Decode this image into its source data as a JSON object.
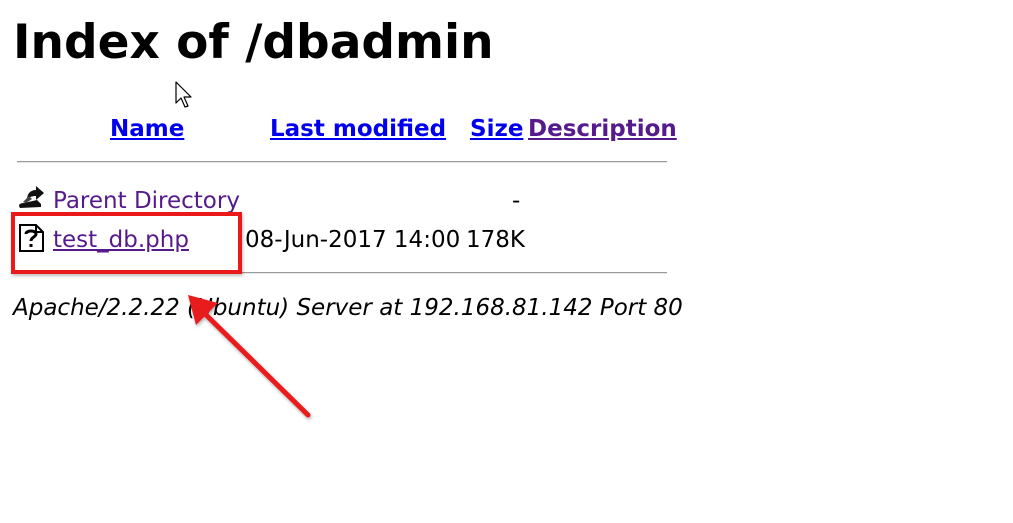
{
  "page": {
    "title": "Index of /dbadmin"
  },
  "table": {
    "headers": {
      "name": "Name",
      "last_modified": "Last modified",
      "size": "Size",
      "description": "Description"
    },
    "rows": [
      {
        "icon": "back-icon",
        "name": "Parent Directory",
        "last_modified": "",
        "size": "-",
        "description": ""
      },
      {
        "icon": "unknown-file-icon",
        "name": "test_db.php",
        "last_modified": "08-Jun-2017 14:00",
        "size": "178K",
        "description": ""
      }
    ]
  },
  "footer": {
    "address": "Apache/2.2.22 (Ubuntu) Server at 192.168.81.142 Port 80"
  },
  "annotation": {
    "highlight_color": "#ea1a1a",
    "arrow_color": "#e81c1c",
    "highlighted_item": "test_db.php"
  },
  "colors": {
    "link": "#0000ee",
    "visited_link": "#551a8b"
  }
}
